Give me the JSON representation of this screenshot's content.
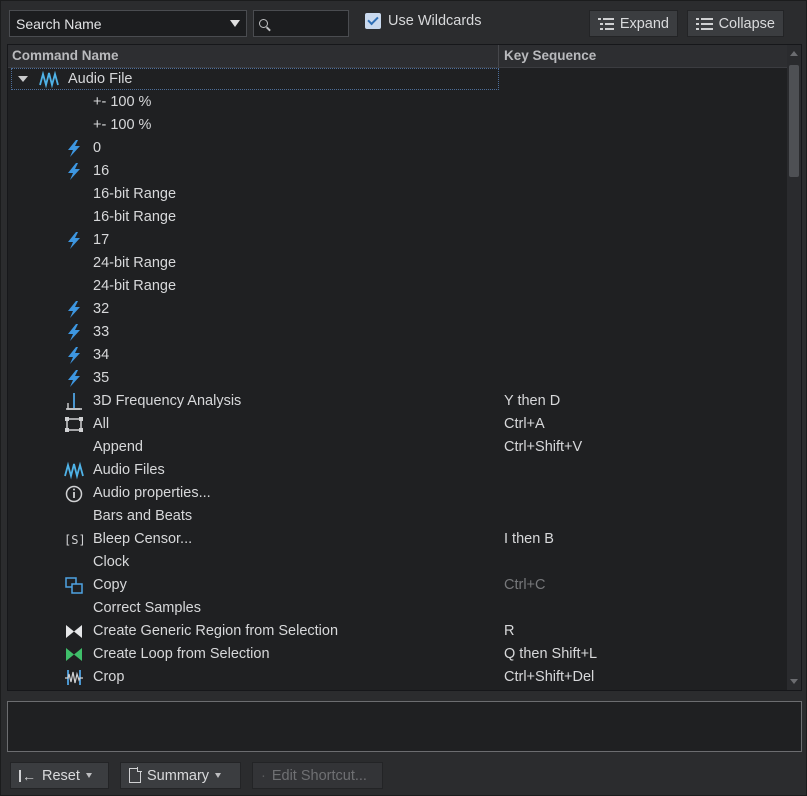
{
  "toolbar": {
    "search_field_value": "Search Name",
    "search_placeholder": "",
    "use_wildcards_label": "Use Wildcards",
    "use_wildcards_checked": true,
    "expand_label": "Expand",
    "collapse_label": "Collapse"
  },
  "table": {
    "columns": [
      "Command Name",
      "Key Sequence"
    ],
    "root": {
      "label": "Audio File",
      "icon": "waveform-icon",
      "expanded": true
    },
    "rows": [
      {
        "name": "+- 100 %",
        "key": "",
        "icon": ""
      },
      {
        "name": "+- 100 %",
        "key": "",
        "icon": ""
      },
      {
        "name": "0",
        "key": "",
        "icon": "lightning-icon"
      },
      {
        "name": "16",
        "key": "",
        "icon": "lightning-icon"
      },
      {
        "name": "16-bit Range",
        "key": "",
        "icon": ""
      },
      {
        "name": "16-bit Range",
        "key": "",
        "icon": ""
      },
      {
        "name": "17",
        "key": "",
        "icon": "lightning-icon"
      },
      {
        "name": "24-bit Range",
        "key": "",
        "icon": ""
      },
      {
        "name": "24-bit Range",
        "key": "",
        "icon": ""
      },
      {
        "name": "32",
        "key": "",
        "icon": "lightning-icon"
      },
      {
        "name": "33",
        "key": "",
        "icon": "lightning-icon"
      },
      {
        "name": "34",
        "key": "",
        "icon": "lightning-icon"
      },
      {
        "name": "35",
        "key": "",
        "icon": "lightning-icon"
      },
      {
        "name": "3D Frequency Analysis",
        "key": "Y then D",
        "icon": "frequency-analysis-icon"
      },
      {
        "name": "All",
        "key": "Ctrl+A",
        "icon": "select-all-icon"
      },
      {
        "name": "Append",
        "key": "Ctrl+Shift+V",
        "icon": ""
      },
      {
        "name": "Audio Files",
        "key": "",
        "icon": "waveform-icon"
      },
      {
        "name": "Audio properties...",
        "key": "",
        "icon": "info-icon"
      },
      {
        "name": "Bars and Beats",
        "key": "",
        "icon": ""
      },
      {
        "name": "Bleep Censor...",
        "key": "I then B",
        "icon": "bleep-censor-icon"
      },
      {
        "name": "Clock",
        "key": "",
        "icon": ""
      },
      {
        "name": "Copy",
        "key": "Ctrl+C",
        "icon": "copy-icon",
        "key_dim": true
      },
      {
        "name": "Correct Samples",
        "key": "",
        "icon": ""
      },
      {
        "name": "Create Generic Region from Selection",
        "key": "R",
        "icon": "region-icon"
      },
      {
        "name": "Create Loop from Selection",
        "key": "Q then Shift+L",
        "icon": "loop-icon"
      },
      {
        "name": "Crop",
        "key": "Ctrl+Shift+Del",
        "icon": "crop-icon"
      }
    ]
  },
  "description": "",
  "footer": {
    "reset_label": "Reset",
    "summary_label": "Summary",
    "edit_shortcut_label": "Edit Shortcut..."
  }
}
